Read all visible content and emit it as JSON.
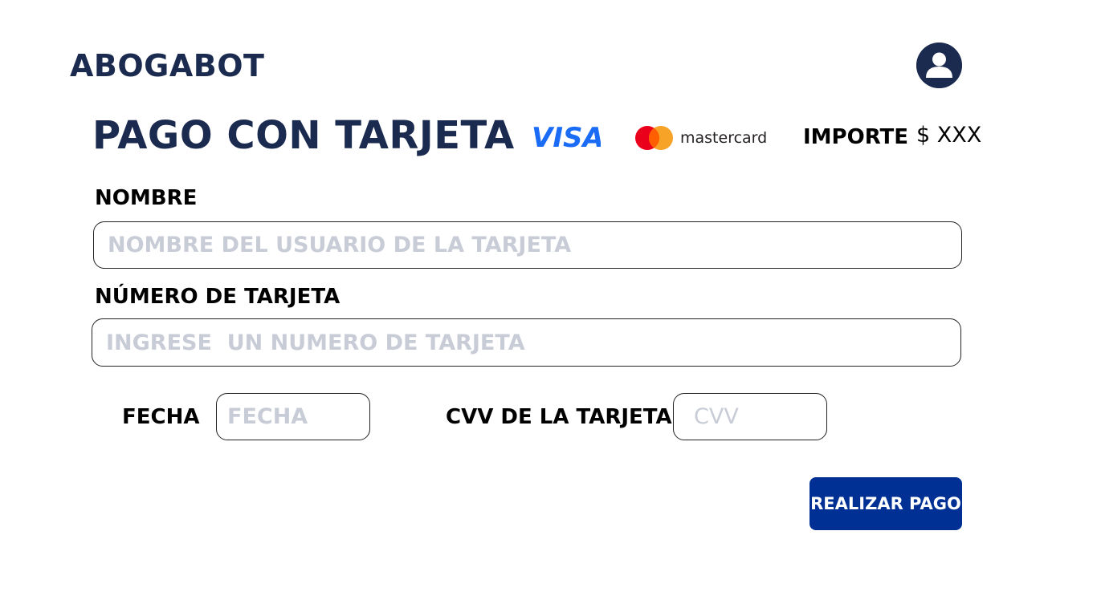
{
  "header": {
    "brand": "ABOGABOT",
    "avatar_icon": "user-icon"
  },
  "payment": {
    "title": "PAGO CON TARJETA",
    "card_brands": [
      {
        "name": "VISA",
        "icon": "visa-logo",
        "color": "#1a6cf6"
      },
      {
        "name": "mastercard",
        "icon": "mastercard-logo",
        "colors": [
          "#eb001b",
          "#f79e1b"
        ]
      }
    ],
    "amount_label": "IMPORTE",
    "amount_value": "$ XXX"
  },
  "form": {
    "name": {
      "label": "NOMBRE",
      "placeholder": "NOMBRE DEL USUARIO DE LA TARJETA",
      "value": ""
    },
    "card_number": {
      "label": "NÚMERO DE TARJETA",
      "placeholder": "INGRESE  UN NUMERO DE TARJETA",
      "value": ""
    },
    "date": {
      "label": "FECHA",
      "placeholder": "FECHA",
      "value": ""
    },
    "cvv": {
      "label": "CVV DE LA TARJETA",
      "placeholder": "CVV",
      "value": ""
    },
    "submit_label": "REALIZAR PAGO"
  },
  "colors": {
    "brand_navy": "#1b2a4f",
    "button_blue": "#003094",
    "placeholder_gray": "#c8ccd6"
  }
}
